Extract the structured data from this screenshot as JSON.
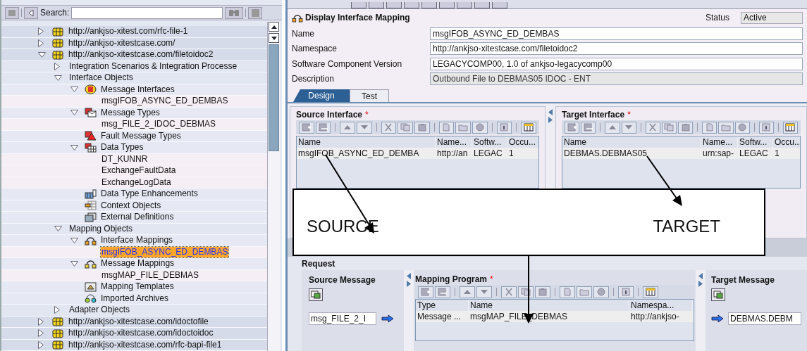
{
  "search": {
    "label": "Search:"
  },
  "tree": [
    {
      "label": "http://ankjso-xitest.com/rfc-file-1",
      "kind": "namespace",
      "expanded": false,
      "selected": false
    },
    {
      "label": "http://ankjso-xitestcase.com/",
      "kind": "namespace",
      "expanded": false,
      "selected": false
    },
    {
      "label": "http://ankjso-xitestcase.com/filetoidoc2",
      "kind": "namespace",
      "expanded": true,
      "selected": false,
      "children": [
        {
          "label": "Integration Scenarios & Integration Processe",
          "expanded": false,
          "selected": false
        },
        {
          "label": "Interface Objects",
          "expanded": true,
          "selected": false,
          "children": [
            {
              "label": "Message Interfaces",
              "kind": "interfaces",
              "expanded": true,
              "selected": false,
              "children": [
                {
                  "label": "msgIFOB_ASYNC_ED_DEMBAS",
                  "selected": false
                }
              ]
            },
            {
              "label": "Message Types",
              "kind": "msgtypes",
              "expanded": true,
              "selected": false,
              "children": [
                {
                  "label": "msg_FILE_2_IDOC_DEBMAS",
                  "selected": false
                }
              ]
            },
            {
              "label": "Fault Message Types",
              "kind": "fault",
              "selected": false
            },
            {
              "label": "Data Types",
              "kind": "datatypes",
              "expanded": true,
              "selected": false,
              "children": [
                {
                  "label": "DT_KUNNR",
                  "selected": false
                },
                {
                  "label": "ExchangeFaultData",
                  "selected": false
                },
                {
                  "label": "ExchangeLogData",
                  "selected": false
                }
              ]
            },
            {
              "label": "Data Type Enhancements",
              "kind": "enhancement",
              "selected": false
            },
            {
              "label": "Context Objects",
              "kind": "context",
              "selected": false
            },
            {
              "label": "External Definitions",
              "kind": "external",
              "selected": false
            }
          ]
        },
        {
          "label": "Mapping Objects",
          "expanded": true,
          "selected": false,
          "children": [
            {
              "label": "Interface Mappings",
              "kind": "ifmap",
              "expanded": true,
              "selected": false,
              "children": [
                {
                  "label": "msgIFOB_ASYNC_ED_DEMBAS",
                  "selected": true
                }
              ]
            },
            {
              "label": "Message Mappings",
              "kind": "msgmap",
              "expanded": true,
              "selected": false,
              "children": [
                {
                  "label": "msgMAP_FILE_DEBMAS",
                  "selected": false
                }
              ]
            },
            {
              "label": "Mapping Templates",
              "kind": "template",
              "selected": false
            },
            {
              "label": "Imported Archives",
              "kind": "archive",
              "selected": false
            }
          ]
        },
        {
          "label": "Adapter Objects",
          "expanded": false,
          "selected": false
        }
      ]
    },
    {
      "label": "http://ankjso-xitestcase.com/idoctofile",
      "kind": "namespace",
      "expanded": false,
      "selected": false
    },
    {
      "label": "http://ankjso-xitestcase.com/idoctoidoc",
      "kind": "namespace",
      "expanded": false,
      "selected": false
    },
    {
      "label": "http://ankjso-xitestcase.com/rfc-bapi-file1",
      "kind": "namespace",
      "expanded": false,
      "selected": false
    }
  ],
  "detail": {
    "title": "Display Interface Mapping",
    "status": {
      "label": "Status",
      "value": "Active"
    },
    "fields": [
      {
        "label": "Name",
        "value": "msgIFOB_ASYNC_ED_DEMBAS",
        "disabled": false
      },
      {
        "label": "Namespace",
        "value": "http://ankjso-xitestcase.com/filetoidoc2",
        "disabled": false
      },
      {
        "label": "Software Component Version",
        "value": "LEGACYCOMP00, 1.0 of ankjso-legacycomp00",
        "disabled": false
      },
      {
        "label": "Description",
        "value": "Outbound File to DEBMAS05 IDOC - ENT",
        "disabled": true
      }
    ]
  },
  "tabs": [
    {
      "label": "Design",
      "selected": true
    },
    {
      "label": "Test",
      "selected": false
    }
  ],
  "interfaces": [
    {
      "title": "Source Interface",
      "required_mark": "*",
      "columns": [
        "Name",
        "Name...",
        "Softw...",
        "Occu..."
      ],
      "rows": [
        [
          "msgIFOB_ASYNC_ED_DEMBA",
          "http://an",
          "LEGAC",
          "1"
        ]
      ]
    },
    {
      "title": "Target Interface",
      "required_mark": "*",
      "columns": [
        "Name",
        "Name...",
        "Softw...",
        "Occu..."
      ],
      "rows": [
        [
          "DEBMAS.DEBMAS05",
          "urn:sap-",
          "LEGAC",
          "1"
        ]
      ]
    }
  ],
  "request": {
    "title": "Request",
    "source_message": {
      "title": "Source Message",
      "value": "msg_FILE_2_I"
    },
    "mapping_program": {
      "title": "Mapping Program",
      "required_mark": "*",
      "columns": [
        "Type",
        "Name",
        "Namespa..."
      ],
      "rows": [
        [
          "Message ...",
          "msgMAP_FILE_DEBMAS",
          "http://ankjso-"
        ]
      ]
    },
    "target_message": {
      "title": "Target Message",
      "value": "DEBMAS.DEBM"
    }
  },
  "annotation": {
    "labels": [
      "SOURCE",
      "TARGET"
    ]
  }
}
